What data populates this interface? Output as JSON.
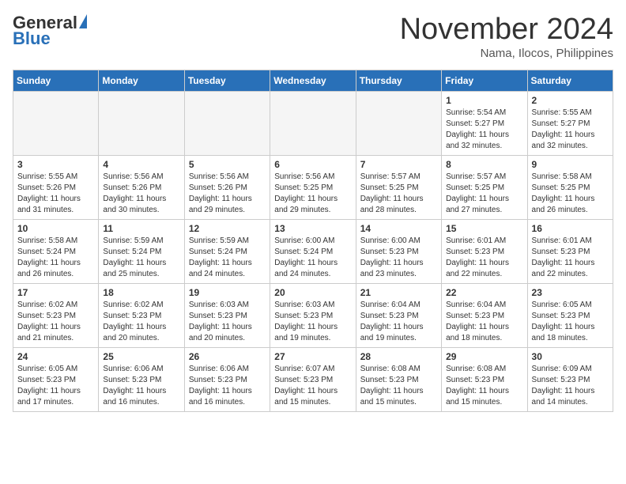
{
  "header": {
    "logo_general": "General",
    "logo_blue": "Blue",
    "month_title": "November 2024",
    "location": "Nama, Ilocos, Philippines"
  },
  "calendar": {
    "days_of_week": [
      "Sunday",
      "Monday",
      "Tuesday",
      "Wednesday",
      "Thursday",
      "Friday",
      "Saturday"
    ],
    "weeks": [
      {
        "days": [
          {
            "number": "",
            "empty": true
          },
          {
            "number": "",
            "empty": true
          },
          {
            "number": "",
            "empty": true
          },
          {
            "number": "",
            "empty": true
          },
          {
            "number": "",
            "empty": true
          },
          {
            "number": "1",
            "sunrise": "Sunrise: 5:54 AM",
            "sunset": "Sunset: 5:27 PM",
            "daylight": "Daylight: 11 hours and 32 minutes."
          },
          {
            "number": "2",
            "sunrise": "Sunrise: 5:55 AM",
            "sunset": "Sunset: 5:27 PM",
            "daylight": "Daylight: 11 hours and 32 minutes."
          }
        ]
      },
      {
        "days": [
          {
            "number": "3",
            "sunrise": "Sunrise: 5:55 AM",
            "sunset": "Sunset: 5:26 PM",
            "daylight": "Daylight: 11 hours and 31 minutes."
          },
          {
            "number": "4",
            "sunrise": "Sunrise: 5:56 AM",
            "sunset": "Sunset: 5:26 PM",
            "daylight": "Daylight: 11 hours and 30 minutes."
          },
          {
            "number": "5",
            "sunrise": "Sunrise: 5:56 AM",
            "sunset": "Sunset: 5:26 PM",
            "daylight": "Daylight: 11 hours and 29 minutes."
          },
          {
            "number": "6",
            "sunrise": "Sunrise: 5:56 AM",
            "sunset": "Sunset: 5:25 PM",
            "daylight": "Daylight: 11 hours and 29 minutes."
          },
          {
            "number": "7",
            "sunrise": "Sunrise: 5:57 AM",
            "sunset": "Sunset: 5:25 PM",
            "daylight": "Daylight: 11 hours and 28 minutes."
          },
          {
            "number": "8",
            "sunrise": "Sunrise: 5:57 AM",
            "sunset": "Sunset: 5:25 PM",
            "daylight": "Daylight: 11 hours and 27 minutes."
          },
          {
            "number": "9",
            "sunrise": "Sunrise: 5:58 AM",
            "sunset": "Sunset: 5:25 PM",
            "daylight": "Daylight: 11 hours and 26 minutes."
          }
        ]
      },
      {
        "days": [
          {
            "number": "10",
            "sunrise": "Sunrise: 5:58 AM",
            "sunset": "Sunset: 5:24 PM",
            "daylight": "Daylight: 11 hours and 26 minutes."
          },
          {
            "number": "11",
            "sunrise": "Sunrise: 5:59 AM",
            "sunset": "Sunset: 5:24 PM",
            "daylight": "Daylight: 11 hours and 25 minutes."
          },
          {
            "number": "12",
            "sunrise": "Sunrise: 5:59 AM",
            "sunset": "Sunset: 5:24 PM",
            "daylight": "Daylight: 11 hours and 24 minutes."
          },
          {
            "number": "13",
            "sunrise": "Sunrise: 6:00 AM",
            "sunset": "Sunset: 5:24 PM",
            "daylight": "Daylight: 11 hours and 24 minutes."
          },
          {
            "number": "14",
            "sunrise": "Sunrise: 6:00 AM",
            "sunset": "Sunset: 5:23 PM",
            "daylight": "Daylight: 11 hours and 23 minutes."
          },
          {
            "number": "15",
            "sunrise": "Sunrise: 6:01 AM",
            "sunset": "Sunset: 5:23 PM",
            "daylight": "Daylight: 11 hours and 22 minutes."
          },
          {
            "number": "16",
            "sunrise": "Sunrise: 6:01 AM",
            "sunset": "Sunset: 5:23 PM",
            "daylight": "Daylight: 11 hours and 22 minutes."
          }
        ]
      },
      {
        "days": [
          {
            "number": "17",
            "sunrise": "Sunrise: 6:02 AM",
            "sunset": "Sunset: 5:23 PM",
            "daylight": "Daylight: 11 hours and 21 minutes."
          },
          {
            "number": "18",
            "sunrise": "Sunrise: 6:02 AM",
            "sunset": "Sunset: 5:23 PM",
            "daylight": "Daylight: 11 hours and 20 minutes."
          },
          {
            "number": "19",
            "sunrise": "Sunrise: 6:03 AM",
            "sunset": "Sunset: 5:23 PM",
            "daylight": "Daylight: 11 hours and 20 minutes."
          },
          {
            "number": "20",
            "sunrise": "Sunrise: 6:03 AM",
            "sunset": "Sunset: 5:23 PM",
            "daylight": "Daylight: 11 hours and 19 minutes."
          },
          {
            "number": "21",
            "sunrise": "Sunrise: 6:04 AM",
            "sunset": "Sunset: 5:23 PM",
            "daylight": "Daylight: 11 hours and 19 minutes."
          },
          {
            "number": "22",
            "sunrise": "Sunrise: 6:04 AM",
            "sunset": "Sunset: 5:23 PM",
            "daylight": "Daylight: 11 hours and 18 minutes."
          },
          {
            "number": "23",
            "sunrise": "Sunrise: 6:05 AM",
            "sunset": "Sunset: 5:23 PM",
            "daylight": "Daylight: 11 hours and 18 minutes."
          }
        ]
      },
      {
        "days": [
          {
            "number": "24",
            "sunrise": "Sunrise: 6:05 AM",
            "sunset": "Sunset: 5:23 PM",
            "daylight": "Daylight: 11 hours and 17 minutes."
          },
          {
            "number": "25",
            "sunrise": "Sunrise: 6:06 AM",
            "sunset": "Sunset: 5:23 PM",
            "daylight": "Daylight: 11 hours and 16 minutes."
          },
          {
            "number": "26",
            "sunrise": "Sunrise: 6:06 AM",
            "sunset": "Sunset: 5:23 PM",
            "daylight": "Daylight: 11 hours and 16 minutes."
          },
          {
            "number": "27",
            "sunrise": "Sunrise: 6:07 AM",
            "sunset": "Sunset: 5:23 PM",
            "daylight": "Daylight: 11 hours and 15 minutes."
          },
          {
            "number": "28",
            "sunrise": "Sunrise: 6:08 AM",
            "sunset": "Sunset: 5:23 PM",
            "daylight": "Daylight: 11 hours and 15 minutes."
          },
          {
            "number": "29",
            "sunrise": "Sunrise: 6:08 AM",
            "sunset": "Sunset: 5:23 PM",
            "daylight": "Daylight: 11 hours and 15 minutes."
          },
          {
            "number": "30",
            "sunrise": "Sunrise: 6:09 AM",
            "sunset": "Sunset: 5:23 PM",
            "daylight": "Daylight: 11 hours and 14 minutes."
          }
        ]
      }
    ]
  }
}
